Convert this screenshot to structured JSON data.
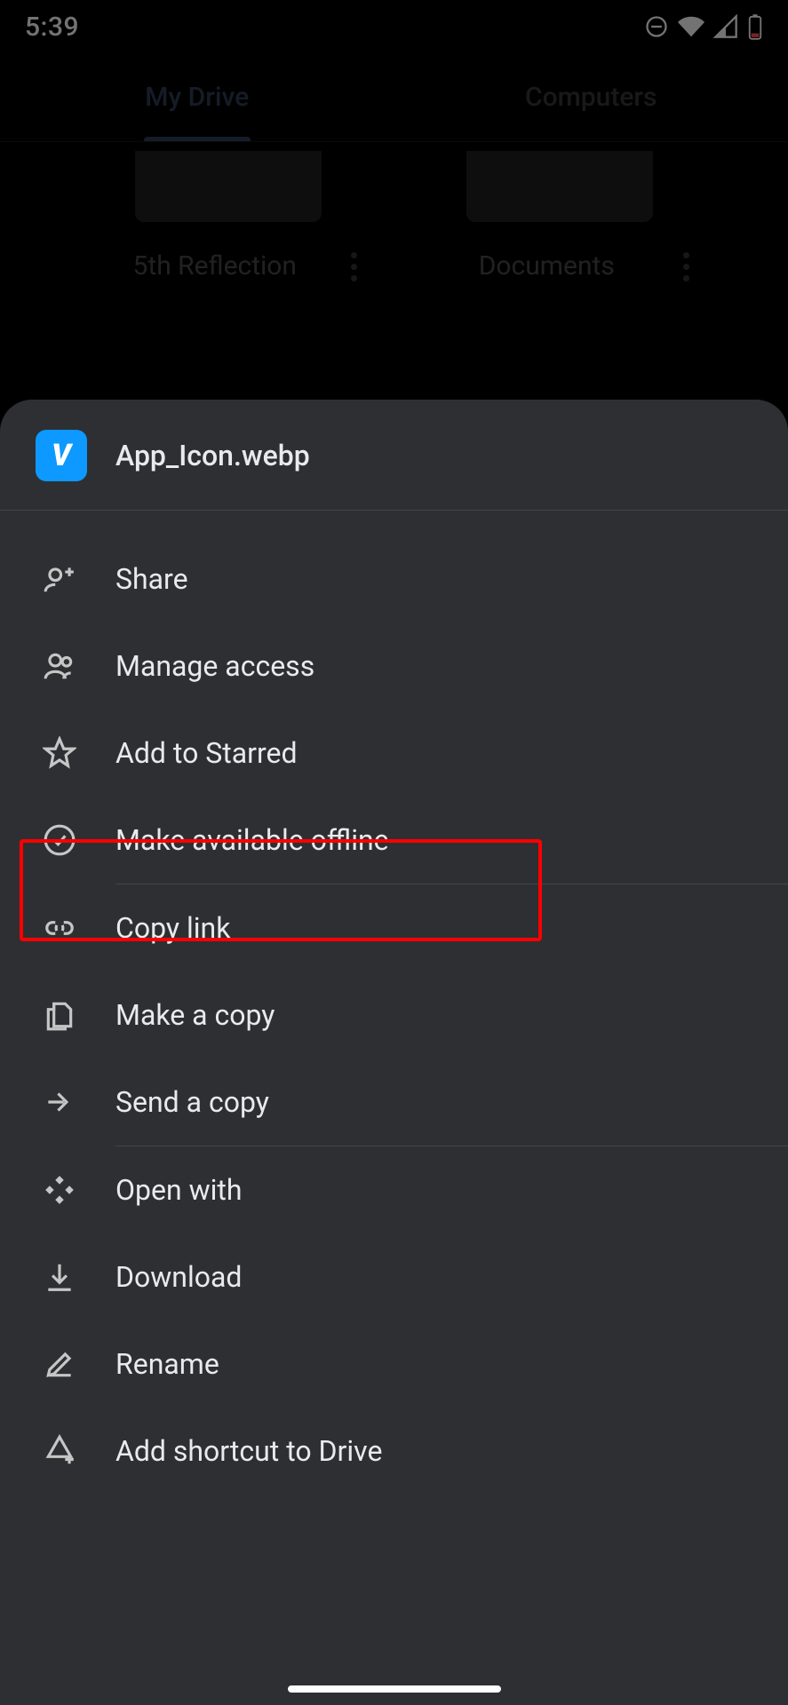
{
  "status": {
    "time": "5:39"
  },
  "tabs": {
    "my_drive": "My Drive",
    "computers": "Computers"
  },
  "background_files": {
    "file1": "5th Reflection",
    "file2": "Documents"
  },
  "sheet": {
    "file_name": "App_Icon.webp",
    "icon_letter": "V"
  },
  "menu": {
    "share": "Share",
    "manage_access": "Manage access",
    "add_starred": "Add to Starred",
    "offline": "Make available offline",
    "copy_link": "Copy link",
    "make_copy": "Make a copy",
    "send_copy": "Send a copy",
    "open_with": "Open with",
    "download": "Download",
    "rename": "Rename",
    "add_shortcut": "Add shortcut to Drive"
  },
  "highlight": {
    "target": "offline"
  }
}
